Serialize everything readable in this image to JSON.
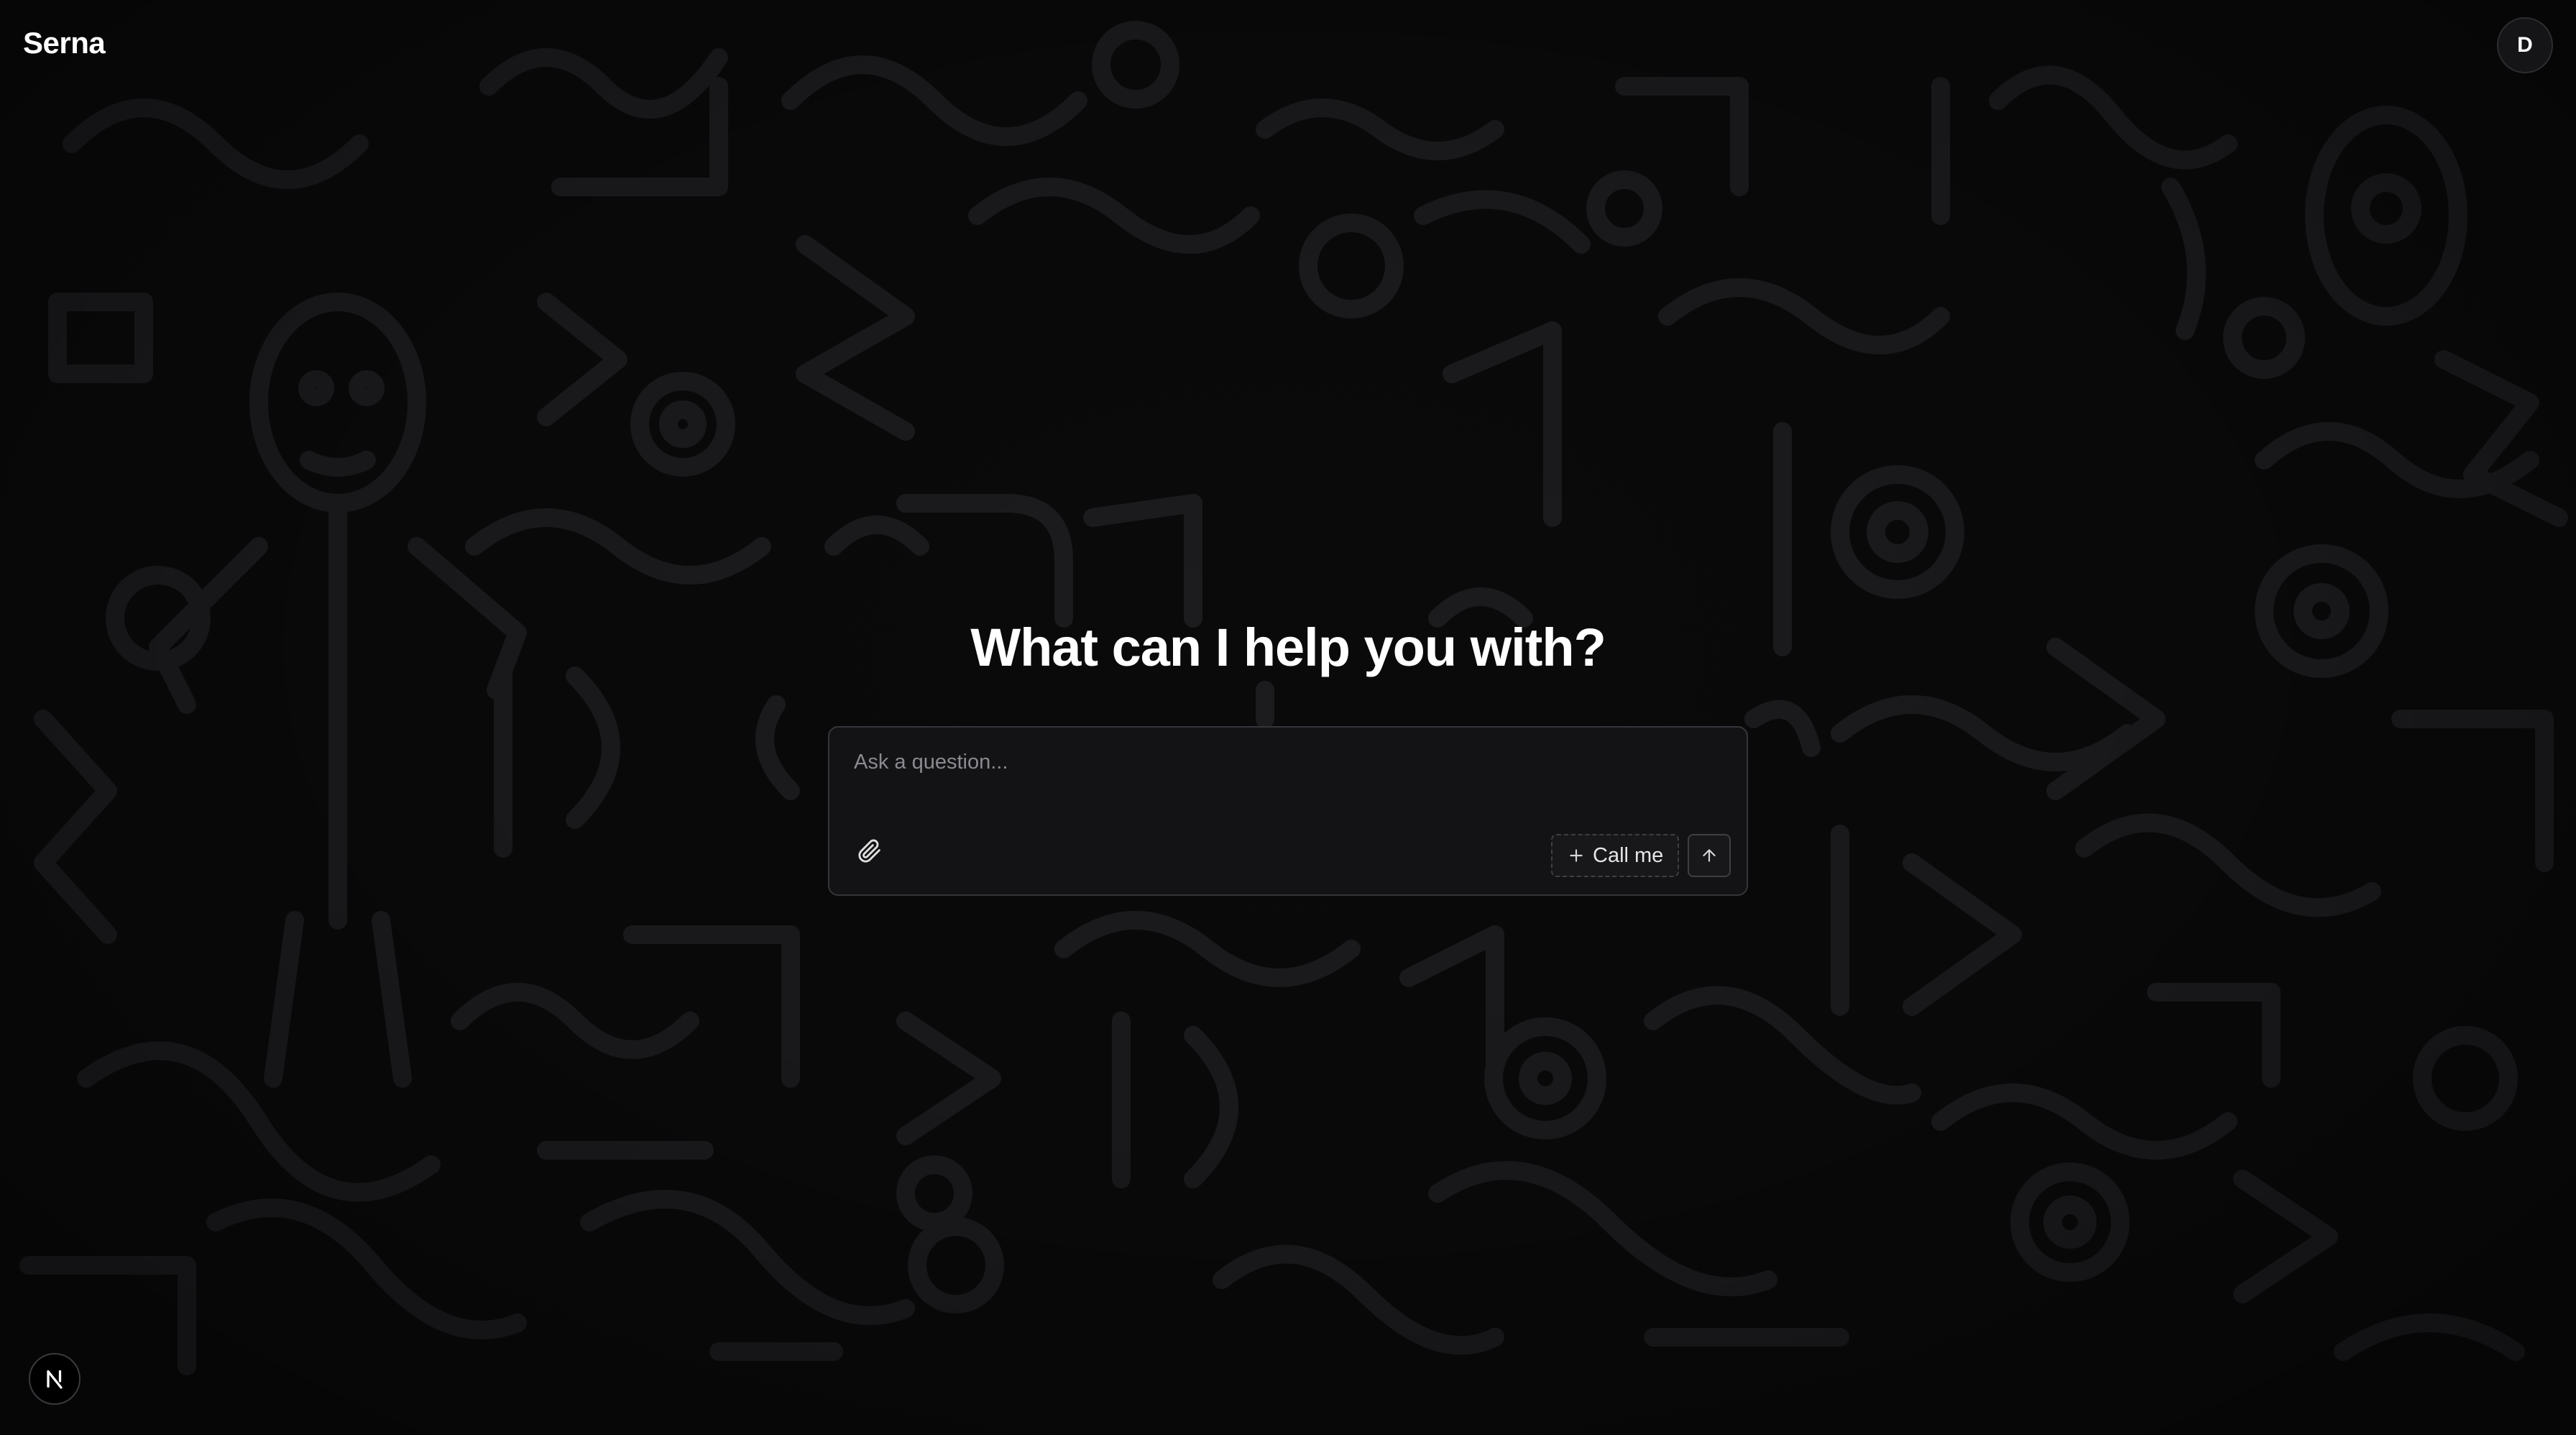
{
  "app": {
    "brand": "Serna",
    "avatar_initial": "D"
  },
  "hero": {
    "headline": "What can I help you with?"
  },
  "composer": {
    "placeholder": "Ask a question...",
    "value": "",
    "attach_icon": "paperclip-icon",
    "call_button_label": "Call me",
    "call_icon": "plus-icon",
    "send_icon": "arrow-up-icon"
  },
  "footer": {
    "badge_icon": "nextjs-n-icon",
    "badge_letter": "N"
  },
  "colors": {
    "background": "#0a0a0b",
    "doodle_stroke": "#1c1c1f",
    "composer_bg": "#141416",
    "composer_border": "#35353a",
    "text_primary": "#ffffff",
    "placeholder": "#8a8a90"
  }
}
